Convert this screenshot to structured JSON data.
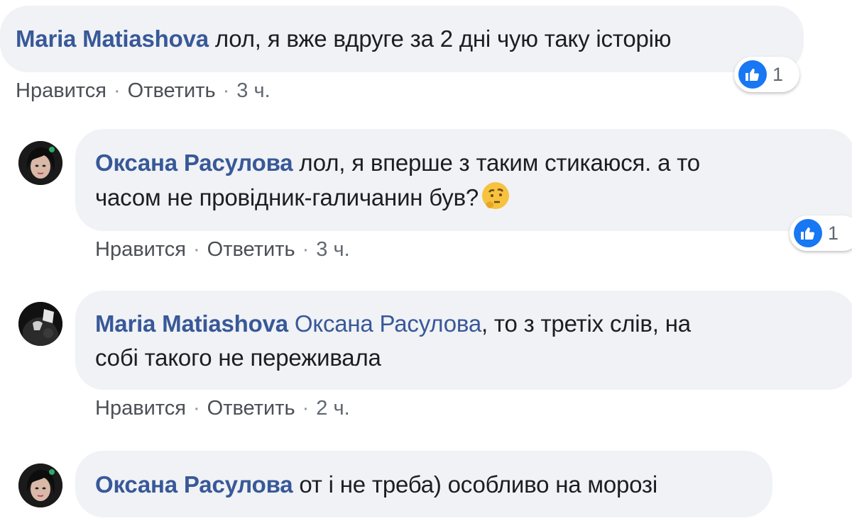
{
  "comments": [
    {
      "author": "Maria Matiashova",
      "text": " лол, я вже вдруге за 2 дні чую таку історію",
      "actions": {
        "like": "Нравится",
        "reply": "Ответить",
        "time": "3 ч."
      },
      "reaction": {
        "icon": "like-icon",
        "count": "1"
      }
    },
    {
      "author": "Оксана Расулова",
      "text_line1": " лол, я вперше з таким стикаюся. а то",
      "text_line2": "часом не провідник-галичанин був?",
      "emoji": "thinking-face-icon",
      "actions": {
        "like": "Нравится",
        "reply": "Ответить",
        "time": "3 ч."
      },
      "reaction": {
        "icon": "like-icon",
        "count": "1"
      }
    },
    {
      "author": "Maria Matiashova",
      "mention": "Оксана Расулова",
      "text_line1": ", то з третіх слів, на",
      "text_line2": "собі такого не переживала",
      "actions": {
        "like": "Нравится",
        "reply": "Ответить",
        "time": "2 ч."
      }
    },
    {
      "author": "Оксана Расулова",
      "text": " от і не треба) особливо на морозі"
    }
  ],
  "colors": {
    "author": "#385898",
    "bubble": "#f0f2f5",
    "like": "#1877f2",
    "meta": "#606770"
  }
}
